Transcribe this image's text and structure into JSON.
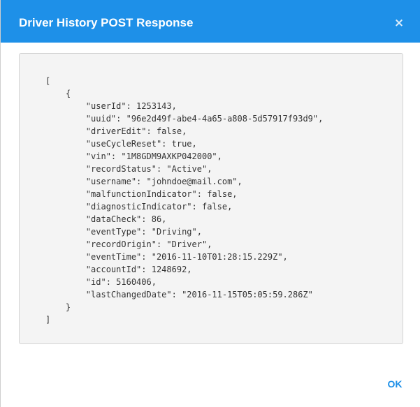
{
  "dialog": {
    "title": "Driver History POST Response",
    "close_icon": "close-icon",
    "close_glyph": "×",
    "ok_label": "OK",
    "accent_color": "#1e90e8",
    "code_lines": [
      "[",
      "    {",
      "        \"userId\": 1253143,",
      "        \"uuid\": \"96e2d49f-abe4-4a65-a808-5d57917f93d9\",",
      "        \"driverEdit\": false,",
      "        \"useCycleReset\": true,",
      "        \"vin\": \"1M8GDM9AXKP042000\",",
      "        \"recordStatus\": \"Active\",",
      "        \"username\": \"johndoe@mail.com\",",
      "        \"malfunctionIndicator\": false,",
      "        \"diagnosticIndicator\": false,",
      "        \"dataCheck\": 86,",
      "        \"eventType\": \"Driving\",",
      "        \"recordOrigin\": \"Driver\",",
      "        \"eventTime\": \"2016-11-10T01:28:15.229Z\",",
      "        \"accountId\": 1248692,",
      "        \"id\": 5160406,",
      "        \"lastChangedDate\": \"2016-11-15T05:05:59.286Z\"",
      "    }",
      "]"
    ]
  }
}
